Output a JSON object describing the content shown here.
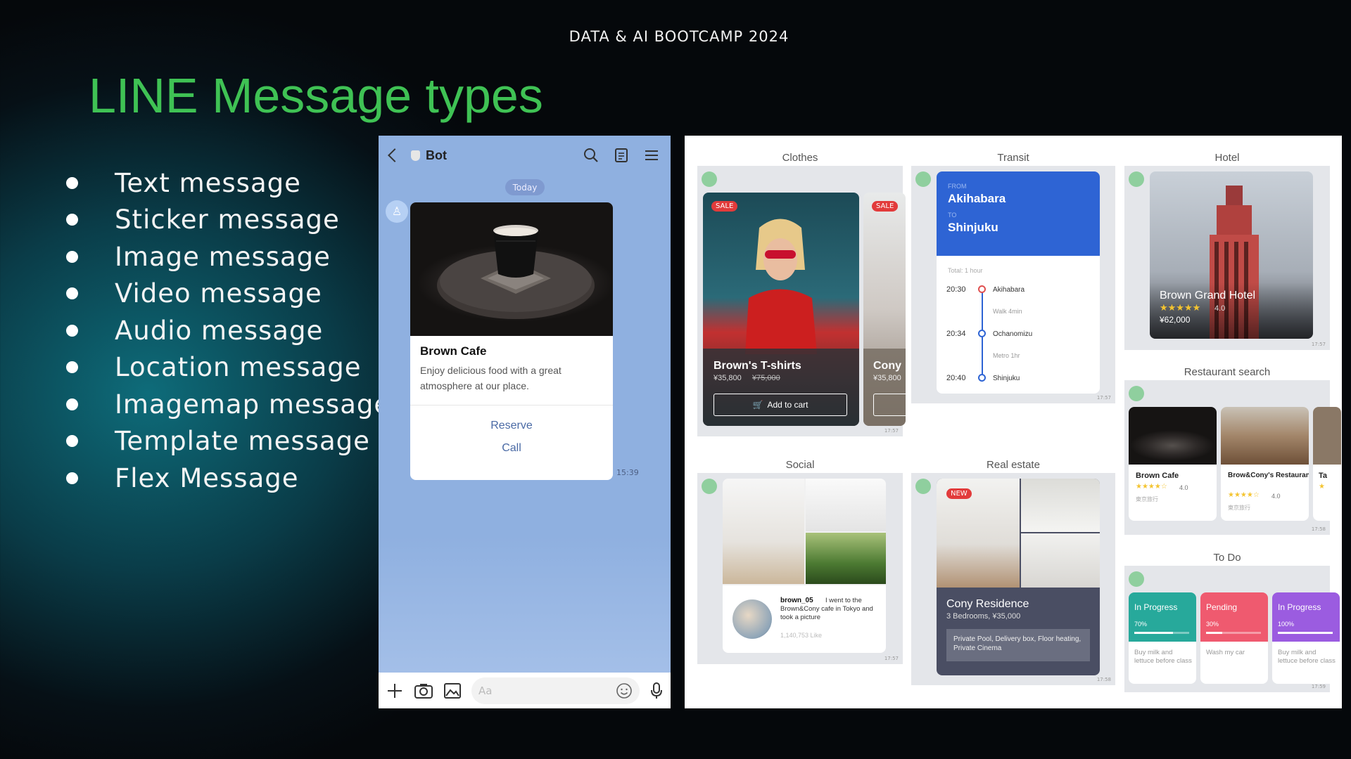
{
  "slide": {
    "header": "DATA & AI BOOTCAMP 2024",
    "title": "LINE Message types",
    "bullets": [
      "Text message",
      "Sticker message",
      "Image message",
      "Video message",
      "Audio message",
      "Location message",
      "Imagemap message",
      "Template message",
      "Flex Message"
    ]
  },
  "phone": {
    "bot_name": "Bot",
    "date_chip": "Today",
    "card": {
      "title": "Brown Cafe",
      "description": "Enjoy delicious food with a great atmosphere at our place.",
      "button_1": "Reserve",
      "button_2": "Call"
    },
    "time": "15:39",
    "input_placeholder": "Aa",
    "icons": {
      "back": "chevron-left-icon",
      "search": "search-icon",
      "notes": "note-icon",
      "menu": "menu-icon",
      "plus": "plus-icon",
      "camera": "camera-icon",
      "image": "image-icon",
      "emoji": "emoji-icon",
      "mic": "microphone-icon"
    }
  },
  "flex": {
    "clothes": {
      "label": "Clothes",
      "sale": "SALE",
      "sale2": "SALE",
      "product": "Brown's T-shirts",
      "price": "¥35,800",
      "old_price": "¥75,000",
      "cart": "Add to cart",
      "next": "Cony",
      "next_price": "¥35,800",
      "time": "17:57"
    },
    "transit": {
      "label": "Transit",
      "from_label": "FROM",
      "from": "Akihabara",
      "to_label": "TO",
      "to": "Shinjuku",
      "total": "Total: 1 hour",
      "stops": [
        {
          "time": "20:30",
          "name": "Akihabara"
        },
        {
          "time": "",
          "name": "Walk 4min"
        },
        {
          "time": "20:34",
          "name": "Ochanomizu"
        },
        {
          "time": "",
          "name": "Metro 1hr"
        },
        {
          "time": "20:40",
          "name": "Shinjuku"
        }
      ],
      "time": "17:57"
    },
    "hotel": {
      "label": "Hotel",
      "name": "Brown Grand Hotel",
      "stars": "★★★★★",
      "rating": "4.0",
      "price": "¥62,000",
      "time": "17:57"
    },
    "restaurant": {
      "label": "Restaurant search",
      "items": [
        {
          "name": "Brown Cafe",
          "stars": "★★★★☆",
          "rating": "4.0",
          "area": "東京旅行"
        },
        {
          "name": "Brow&Cony's Restaurant",
          "stars": "★★★★☆",
          "rating": "4.0",
          "area": "東京旅行"
        },
        {
          "name": "Ta",
          "stars": "★",
          "rating": "",
          "area": ""
        }
      ],
      "time": "17:58"
    },
    "social": {
      "label": "Social",
      "user": "brown_05",
      "text": "I went to the Brown&Cony cafe in Tokyo and took a picture",
      "likes": "1,140,753 Like",
      "time": "17:57"
    },
    "realestate": {
      "label": "Real estate",
      "tag": "NEW",
      "name": "Cony Residence",
      "details": "3 Bedrooms, ¥35,000",
      "features": "Private Pool, Delivery box, Floor heating, Private Cinema",
      "time": "17:58"
    },
    "todo": {
      "label": "To Do",
      "items": [
        {
          "status": "In Progress",
          "percent": "70%",
          "progress": 0.7,
          "task": "Buy milk and lettuce before class",
          "color": "#27a99b"
        },
        {
          "status": "Pending",
          "percent": "30%",
          "progress": 0.3,
          "task": "Wash my car",
          "color": "#ef5a6f"
        },
        {
          "status": "In Progress",
          "percent": "100%",
          "progress": 1.0,
          "task": "Buy milk and lettuce before class",
          "color": "#9b5ce0"
        }
      ],
      "time": "17:59"
    }
  }
}
